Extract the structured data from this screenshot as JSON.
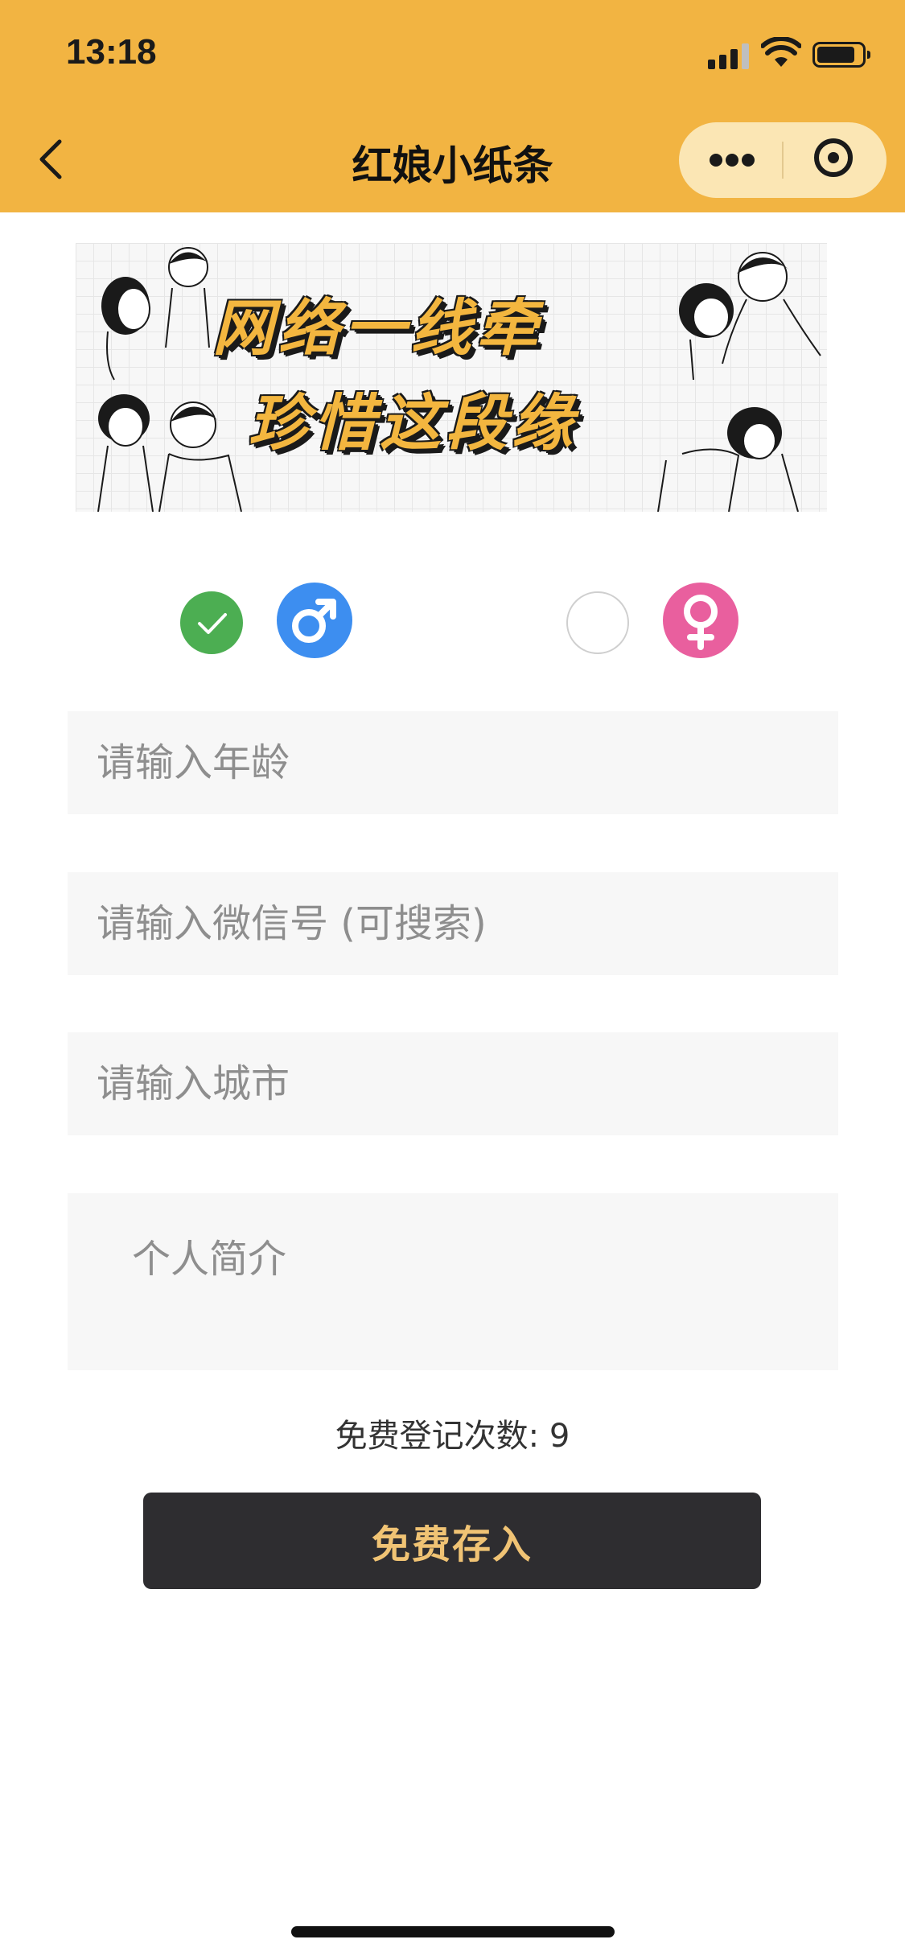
{
  "status_bar": {
    "time": "13:18"
  },
  "nav": {
    "title": "红娘小纸条",
    "back_icon": "chevron-left-icon",
    "more_icon": "more-dots-icon",
    "close_icon": "target-close-icon"
  },
  "banner": {
    "line1": "网络一线牵",
    "line2": "珍惜这段缘"
  },
  "gender": {
    "male": {
      "selected": true,
      "icon": "male-symbol-icon",
      "color": "#3d8ef0"
    },
    "female": {
      "selected": false,
      "icon": "female-symbol-icon",
      "color": "#e95f9e"
    },
    "check_color": "#4cae52"
  },
  "form": {
    "age_placeholder": "请输入年龄",
    "wechat_placeholder": "请输入微信号 (可搜索)",
    "city_placeholder": "请输入城市",
    "intro_placeholder": "个人简介"
  },
  "footer": {
    "counter": "免费登记次数: 9",
    "submit_label": "免费存入"
  },
  "colors": {
    "header_bg": "#f2b442",
    "button_bg": "#2e2d30",
    "button_text": "#f0c374"
  }
}
